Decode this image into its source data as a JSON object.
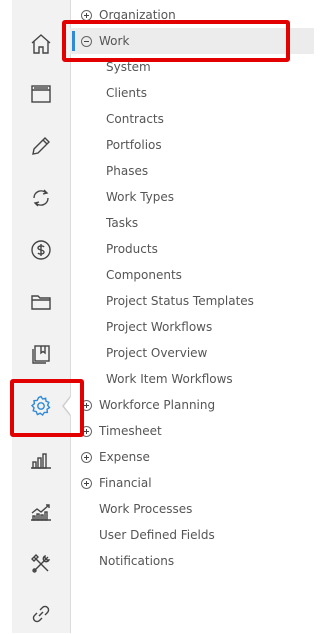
{
  "menu": {
    "organization": "Organization",
    "work": "Work",
    "work_items": [
      "System",
      "Clients",
      "Contracts",
      "Portfolios",
      "Phases",
      "Work Types",
      "Tasks",
      "Products",
      "Components",
      "Project Status Templates",
      "Project Workflows",
      "Project Overview",
      "Work Item Workflows"
    ],
    "workforce_planning": "Workforce Planning",
    "timesheet": "Timesheet",
    "expense": "Expense",
    "financial": "Financial",
    "work_processes": "Work Processes",
    "user_defined_fields": "User Defined Fields",
    "notifications": "Notifications"
  },
  "rail_icons": [
    "home-icon",
    "browser-window-icon",
    "pencil-icon",
    "sync-icon",
    "dollar-icon",
    "folder-icon",
    "bookmark-book-icon",
    "gear-icon",
    "bar-chart-icon",
    "line-chart-icon",
    "tools-icon",
    "link-icon"
  ],
  "accent_color": "#2e8ad8",
  "highlight_color": "#e20000"
}
